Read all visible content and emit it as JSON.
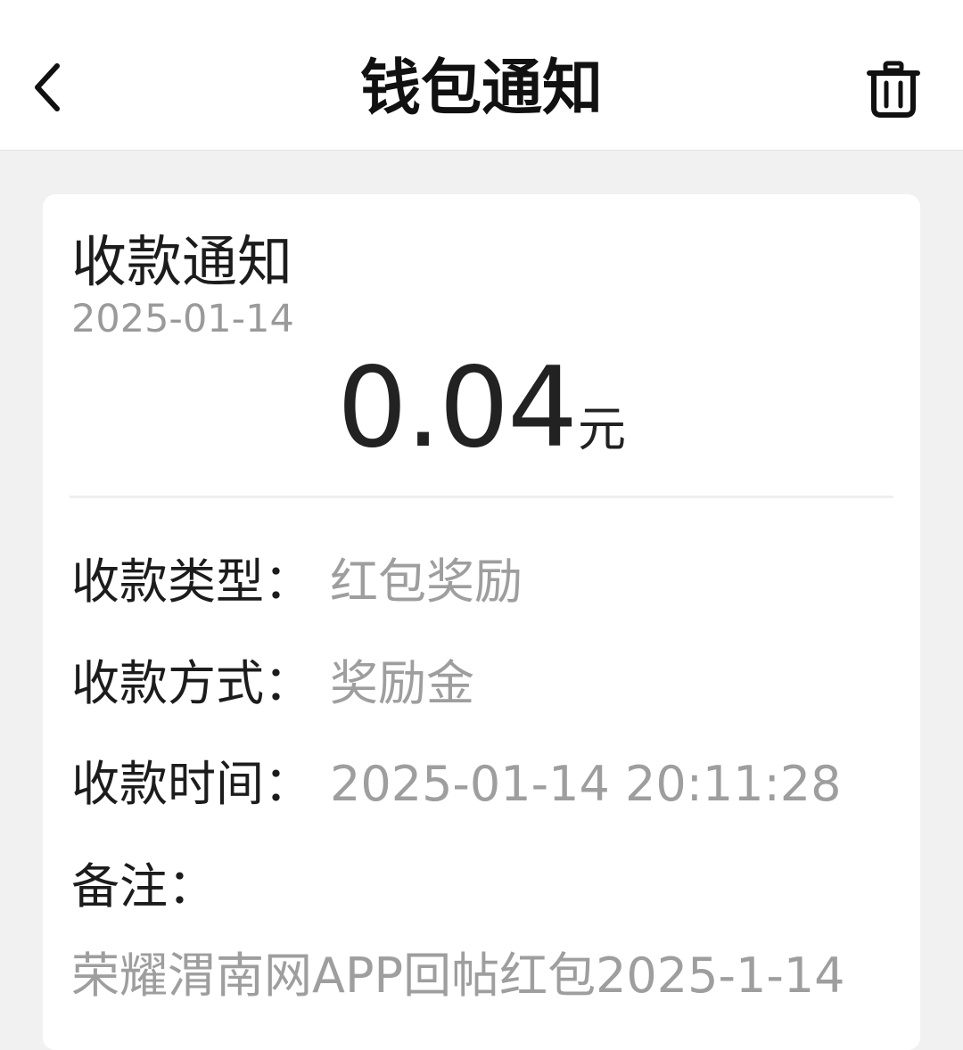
{
  "header": {
    "title": "钱包通知",
    "back_icon": "chevron-left-icon",
    "delete_icon": "trash-icon"
  },
  "notice": {
    "title": "收款通知",
    "date": "2025-01-14",
    "amount": "0.04",
    "unit": "元",
    "details": [
      {
        "label": "收款类型：",
        "value": "红包奖励"
      },
      {
        "label": "收款方式：",
        "value": "奖励金"
      },
      {
        "label": "收款时间：",
        "value": "2025-01-14 20:11:28"
      }
    ],
    "memo_label": "备注：",
    "memo": "荣耀渭南网APP回帖红包2025-1-14"
  },
  "colors": {
    "background": "#f1f1f1",
    "card": "#ffffff",
    "primary_text": "#1c1c1c",
    "secondary_text": "#9e9e9e"
  }
}
